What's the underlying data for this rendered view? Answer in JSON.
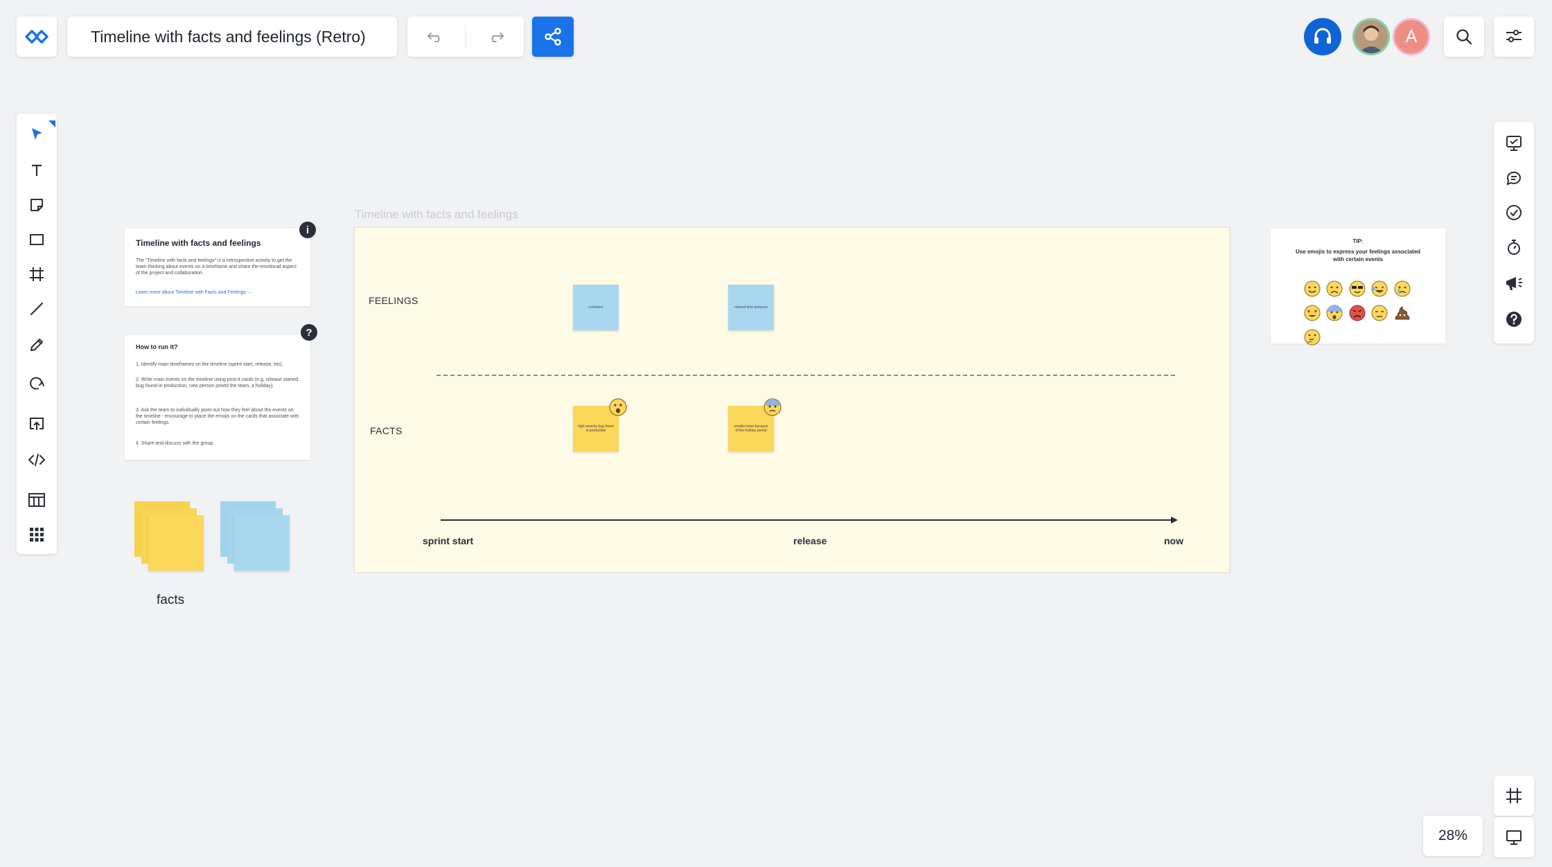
{
  "header": {
    "title": "Timeline with facts and feelings (Retro)",
    "avatar_initial": "A"
  },
  "icons": {
    "logo": "infinity-logo-icon",
    "undo": "undo-icon",
    "redo": "redo-icon",
    "share": "share-icon",
    "headset": "headset-icon",
    "search": "search-icon",
    "settings": "sliders-icon"
  },
  "left_toolbar": [
    {
      "name": "select-tool",
      "icon": "cursor-arrow-icon",
      "active": true
    },
    {
      "name": "text-tool",
      "icon": "text-icon"
    },
    {
      "name": "sticky-note-tool",
      "icon": "sticky-note-icon"
    },
    {
      "name": "shape-tool",
      "icon": "rectangle-icon"
    },
    {
      "name": "frame-tool",
      "icon": "frame-icon"
    },
    {
      "name": "line-tool",
      "icon": "line-icon"
    },
    {
      "name": "pen-tool",
      "icon": "pencil-icon"
    },
    {
      "name": "comment-shape-tool",
      "icon": "lasso-icon"
    },
    {
      "name": "upload-tool",
      "icon": "upload-icon"
    },
    {
      "name": "embed-tool",
      "icon": "code-icon"
    },
    {
      "name": "templates-tool",
      "icon": "templates-icon"
    },
    {
      "name": "apps-tool",
      "icon": "grid-icon"
    }
  ],
  "right_toolbar": [
    {
      "name": "presentation-tool",
      "icon": "presentation-icon"
    },
    {
      "name": "comments-tool",
      "icon": "chat-icon"
    },
    {
      "name": "tasks-tool",
      "icon": "check-circle-icon"
    },
    {
      "name": "timer-tool",
      "icon": "stopwatch-icon"
    },
    {
      "name": "announce-tool",
      "icon": "megaphone-icon"
    },
    {
      "name": "help-tool",
      "icon": "help-icon"
    }
  ],
  "zoom": {
    "label": "28%",
    "value": 28
  },
  "about_card": {
    "title": "Timeline with facts and feelings",
    "body": "The \"Timeline with facts and feelings\" is a retrospective activity to get the team thinking about events on a timeframe and share the emotional aspect of the project and collaboration.",
    "link": "Learn more about Timeline with Facts and Feelings →"
  },
  "howto_card": {
    "title": "How to run it?",
    "steps": [
      "1. Identify main timeframes on the timeline (sprint start, release, etc).",
      "2. Write main events on the timeline using post-it cards (e.g. release started, bug found in production, new person joined the team, a holiday).",
      "3. Ask the team to individually point out how they feel about the events on the timeline - encourage to place the emojis on the cards that associate with certain feelings.",
      "4. Share and discuss with the group."
    ]
  },
  "stacks": {
    "facts_label": "facts"
  },
  "board": {
    "frame_label": "Timeline with facts and feelings",
    "feelings_label": "FEELINGS",
    "facts_label": "FACTS",
    "feelings_notes": [
      "confusion",
      "relaxed time pressure"
    ],
    "facts_notes": [
      "high severity bug found in production",
      "smaller team because of the holiday period"
    ],
    "axis": [
      "sprint start",
      "release",
      "now"
    ]
  },
  "tip": {
    "title": "TIP:",
    "text": "Use emojis to express your feelings associated with certain events"
  },
  "colors": {
    "accent": "#1a73e8",
    "frame_bg": "#fdfbe6",
    "sticky_yellow": "#fbd75a",
    "sticky_blue": "#a8d8f0"
  }
}
